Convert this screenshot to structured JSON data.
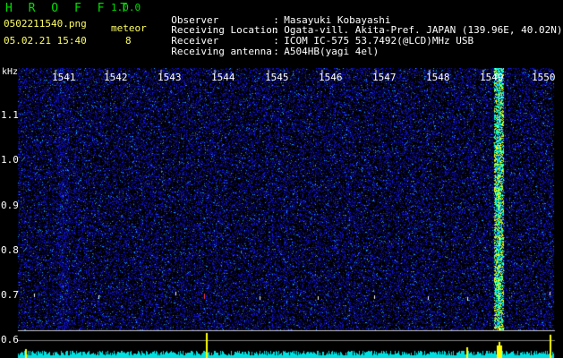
{
  "colors": {
    "background": "#000000",
    "title_green": "#00e000",
    "meta_yellow": "#ffff66",
    "info_white": "#ffffff",
    "spectrum_blue": "#1010ff",
    "spectrum_cyan": "#00ffff",
    "signal_yellow": "#ffff00"
  },
  "header": {
    "app_name": "H R O F F T",
    "version": "1.0.0",
    "filename": "0502211540.png",
    "timestamp": "05.02.21 15:40",
    "meteor_label": "meteor",
    "meteor_count": "8"
  },
  "info": [
    {
      "key": "Observer",
      "sep": ":",
      "value": "Masayuki Kobayashi"
    },
    {
      "key": "Receiving Location",
      "sep": ":",
      "value": "Ogata-vill. Akita-Pref. JAPAN (139.96E, 40.02N)"
    },
    {
      "key": "Receiver",
      "sep": ":",
      "value": "ICOM IC-575 53.7492(@LCD)MHz USB"
    },
    {
      "key": "Receiving antenna",
      "sep": ":",
      "value": "A504HB(yagi 4el)"
    }
  ],
  "chart_data": {
    "type": "heatmap",
    "time_labels": [
      "1541",
      "1542",
      "1543",
      "1544",
      "1545",
      "1546",
      "1547",
      "1548",
      "1549",
      "1550"
    ],
    "y_unit": "kHz",
    "y_labels": [
      "1.1",
      "1.0",
      "0.9",
      "0.8",
      "0.7",
      "0.6"
    ],
    "y_range": [
      0.6,
      1.15
    ],
    "strong_signal_near": "1549"
  }
}
